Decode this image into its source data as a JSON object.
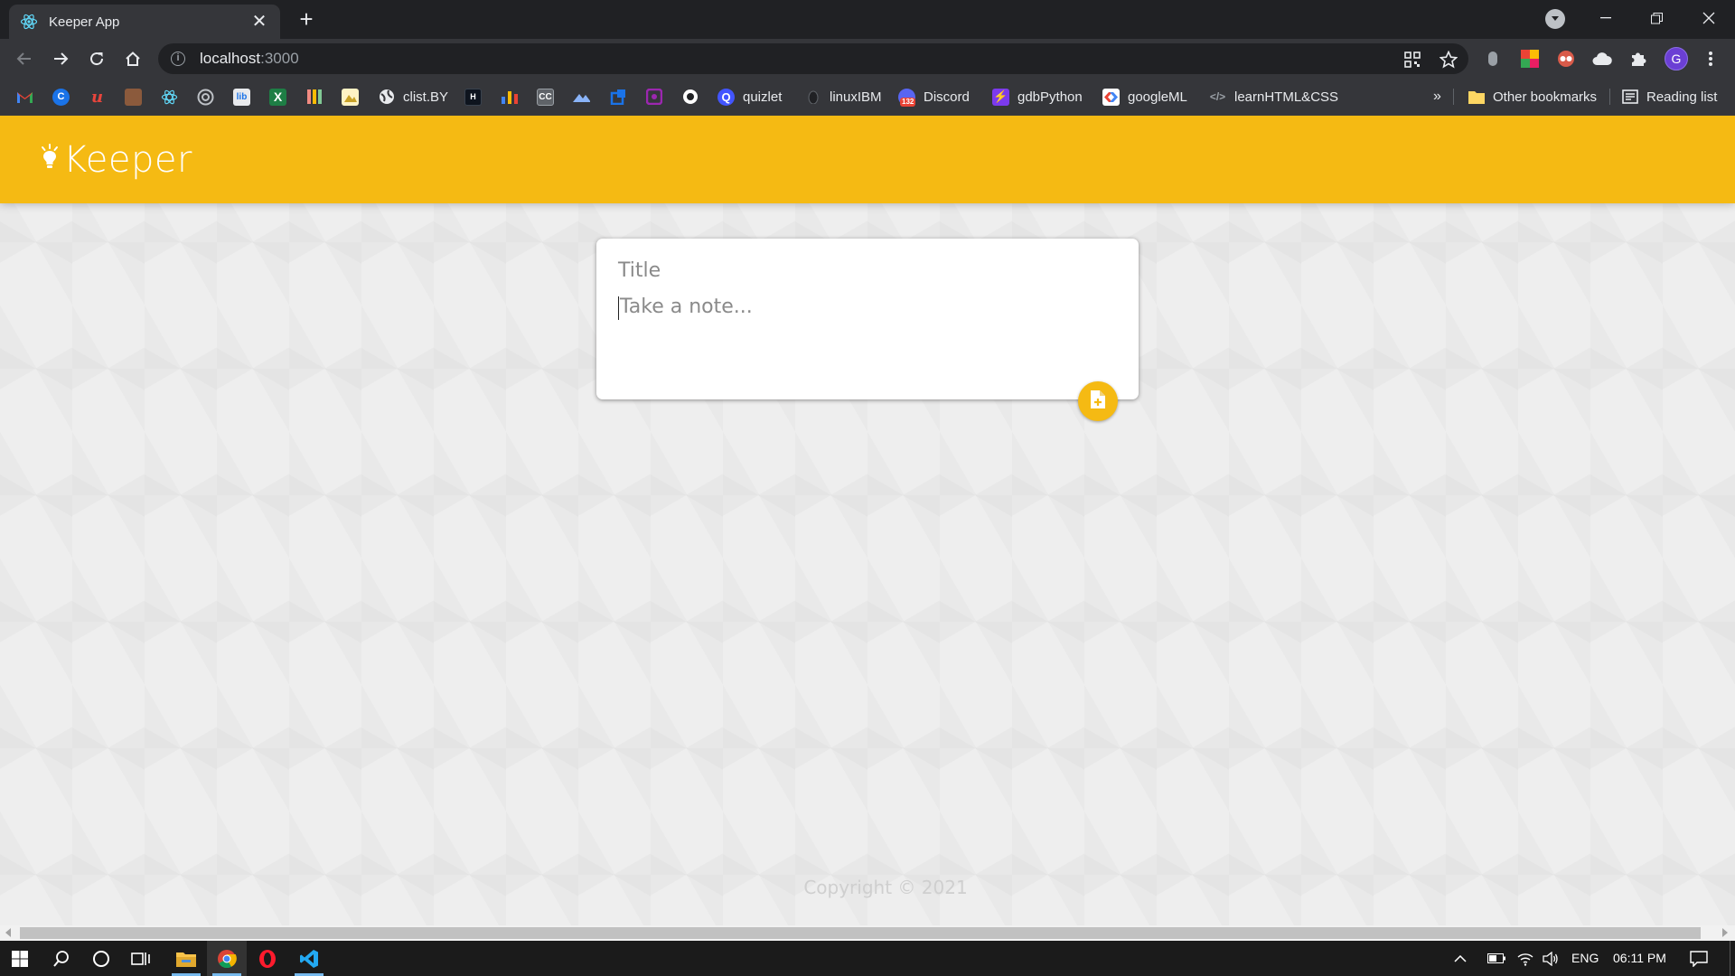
{
  "browser": {
    "tab_title": "Keeper App",
    "url_host": "localhost",
    "url_port": ":3000",
    "profile_initial": "G"
  },
  "bookmarks": [
    {
      "label": "",
      "icon": "gmail-icon"
    },
    {
      "label": "",
      "icon": "c-icon"
    },
    {
      "label": "",
      "icon": "u-icon"
    },
    {
      "label": "",
      "icon": "avatar-icon"
    },
    {
      "label": "",
      "icon": "react-icon"
    },
    {
      "label": "",
      "icon": "edge-icon"
    },
    {
      "label": "",
      "icon": "box-icon"
    },
    {
      "label": "",
      "icon": "x-icon"
    },
    {
      "label": "",
      "icon": "bars-icon"
    },
    {
      "label": "",
      "icon": "image-icon"
    },
    {
      "label": "clist.BY",
      "icon": "globe-icon"
    },
    {
      "label": "",
      "icon": "hackerrank-icon"
    },
    {
      "label": "",
      "icon": "chart-icon"
    },
    {
      "label": "",
      "icon": "cc-icon"
    },
    {
      "label": "",
      "icon": "mountain-icon"
    },
    {
      "label": "",
      "icon": "blue-square-icon"
    },
    {
      "label": "",
      "icon": "purple-icon"
    },
    {
      "label": "",
      "icon": "circle-icon"
    },
    {
      "label": "quizlet",
      "icon": "quizlet-icon"
    },
    {
      "label": "linuxIBM",
      "icon": "linux-icon"
    },
    {
      "label": "Discord",
      "icon": "discord-icon",
      "badge": "132"
    },
    {
      "label": "gdbPython",
      "icon": "bolt-icon"
    },
    {
      "label": "googleML",
      "icon": "google-icon"
    },
    {
      "label": "learnHTML&CSS",
      "icon": "code-icon"
    }
  ],
  "bookmarks_overflow": "»",
  "other_bookmarks": "Other bookmarks",
  "reading_list": "Reading list",
  "app": {
    "logo_text": "Keeper",
    "form": {
      "title_placeholder": "Title",
      "content_placeholder": "Take a note..."
    },
    "footer": "Copyright © 2021"
  },
  "taskbar": {
    "language": "ENG",
    "time": "06:11 PM"
  },
  "colors": {
    "brand": "#f5ba13",
    "background": "#eeeeee"
  }
}
